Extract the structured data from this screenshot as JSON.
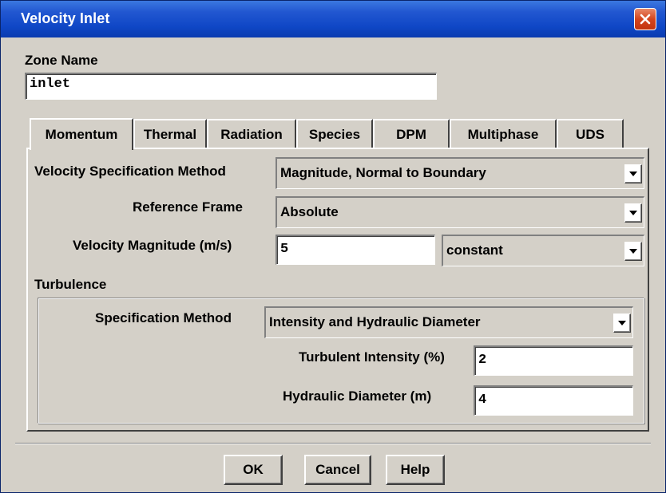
{
  "window": {
    "title": "Velocity Inlet",
    "close_icon": "close-x-icon"
  },
  "zone": {
    "label": "Zone Name",
    "value": "inlet"
  },
  "tabs": [
    {
      "label": "Momentum",
      "active": true
    },
    {
      "label": "Thermal",
      "active": false
    },
    {
      "label": "Radiation",
      "active": false
    },
    {
      "label": "Species",
      "active": false
    },
    {
      "label": "DPM",
      "active": false
    },
    {
      "label": "Multiphase",
      "active": false
    },
    {
      "label": "UDS",
      "active": false
    }
  ],
  "momentum": {
    "velocity_spec": {
      "label": "Velocity Specification Method",
      "value": "Magnitude, Normal to Boundary"
    },
    "reference_frame": {
      "label": "Reference Frame",
      "value": "Absolute"
    },
    "velocity_magnitude": {
      "label": "Velocity Magnitude (m/s)",
      "value": "5",
      "profile": "constant"
    }
  },
  "turbulence": {
    "heading": "Turbulence",
    "spec_method": {
      "label": "Specification Method",
      "value": "Intensity and Hydraulic Diameter"
    },
    "intensity": {
      "label": "Turbulent Intensity (%)",
      "value": "2"
    },
    "hydraulic_diameter": {
      "label": "Hydraulic Diameter (m)",
      "value": "4"
    }
  },
  "buttons": {
    "ok": "OK",
    "cancel": "Cancel",
    "help": "Help"
  },
  "colors": {
    "titlebar": "#0f47c6",
    "dialog_bg": "#d4d0c8",
    "close_btn": "#d4451e"
  }
}
